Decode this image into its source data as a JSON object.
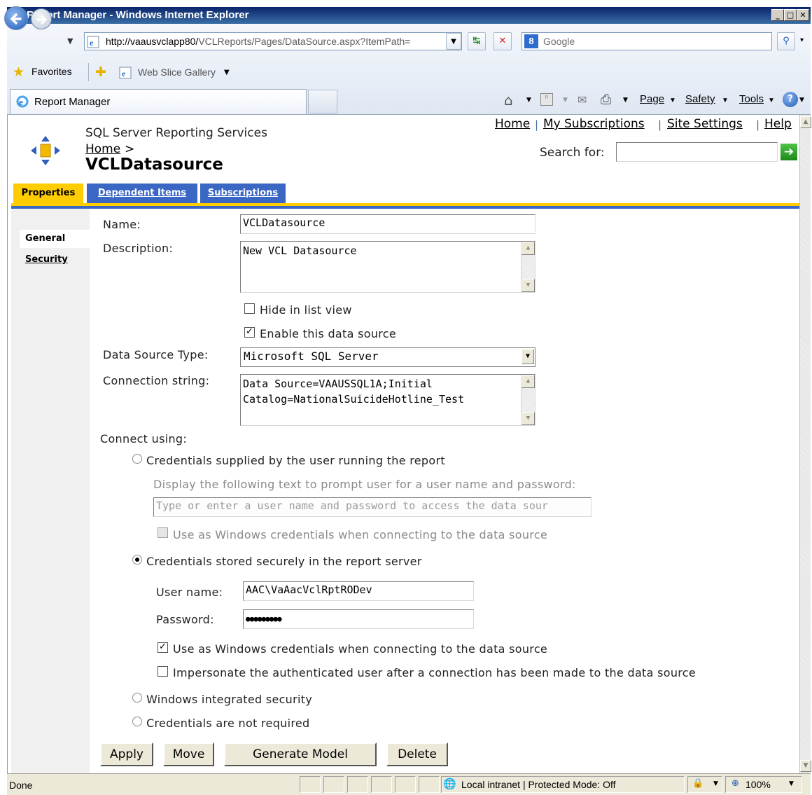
{
  "browser": {
    "window_title": "Report Manager - Windows Internet Explorer",
    "address_host": "http://vaausvclapp80/",
    "address_path": "VCLReports/Pages/DataSource.aspx?ItemPath=",
    "search_provider": "Google",
    "favorites_label": "Favorites",
    "web_slice_label": "Web Slice Gallery",
    "tab_title": "Report Manager",
    "command_bar": {
      "page": "Page",
      "safety": "Safety",
      "tools": "Tools"
    }
  },
  "header": {
    "product": "SQL Server Reporting Services",
    "breadcrumb_home": "Home",
    "breadcrumb_sep": ">",
    "page_title": "VCLDatasource",
    "links": [
      "Home",
      "My Subscriptions",
      "Site Settings",
      "Help"
    ],
    "search_label": "Search for:"
  },
  "tabs": [
    "Properties",
    "Dependent Items",
    "Subscriptions"
  ],
  "left_nav": [
    "General",
    "Security"
  ],
  "form": {
    "name_label": "Name:",
    "name_value": "VCLDatasource",
    "description_label": "Description:",
    "description_value": "New VCL Datasource",
    "hide_label": "Hide in list view",
    "hide_checked": false,
    "enable_label": "Enable this data source",
    "enable_checked": true,
    "type_label": "Data Source Type:",
    "type_value": "Microsoft SQL Server",
    "connstr_label": "Connection string:",
    "connstr_line1": "Data Source=VAAUSSQL1A;Initial",
    "connstr_line2": "Catalog=NationalSuicideHotline_Test",
    "connect_using_label": "Connect using:",
    "opt_user_supplied": "Credentials supplied by the user running the report",
    "prompt_label": "Display the following text to prompt user for a user name and password:",
    "prompt_value": "Type or enter a user name and password to access the data sour",
    "user_win_creds_label": "Use as Windows credentials when connecting to the data source",
    "opt_stored": "Credentials stored securely in the report server",
    "username_label": "User name:",
    "username_value": "AAC\\VaAacVclRptRODev",
    "password_label": "Password:",
    "password_value": "●●●●●●●●●",
    "stored_win_creds_label": "Use as Windows credentials when connecting to the data source",
    "stored_win_creds_checked": true,
    "impersonate_label": "Impersonate the authenticated user after a connection has been made to the data source",
    "impersonate_checked": false,
    "opt_integrated": "Windows integrated security",
    "opt_not_required": "Credentials are not required",
    "selected_option": "stored"
  },
  "buttons": [
    "Apply",
    "Move",
    "Generate Model",
    "Delete"
  ],
  "status": {
    "text": "Done",
    "zone": "Local intranet | Protected Mode: Off",
    "zoom": "100%"
  }
}
